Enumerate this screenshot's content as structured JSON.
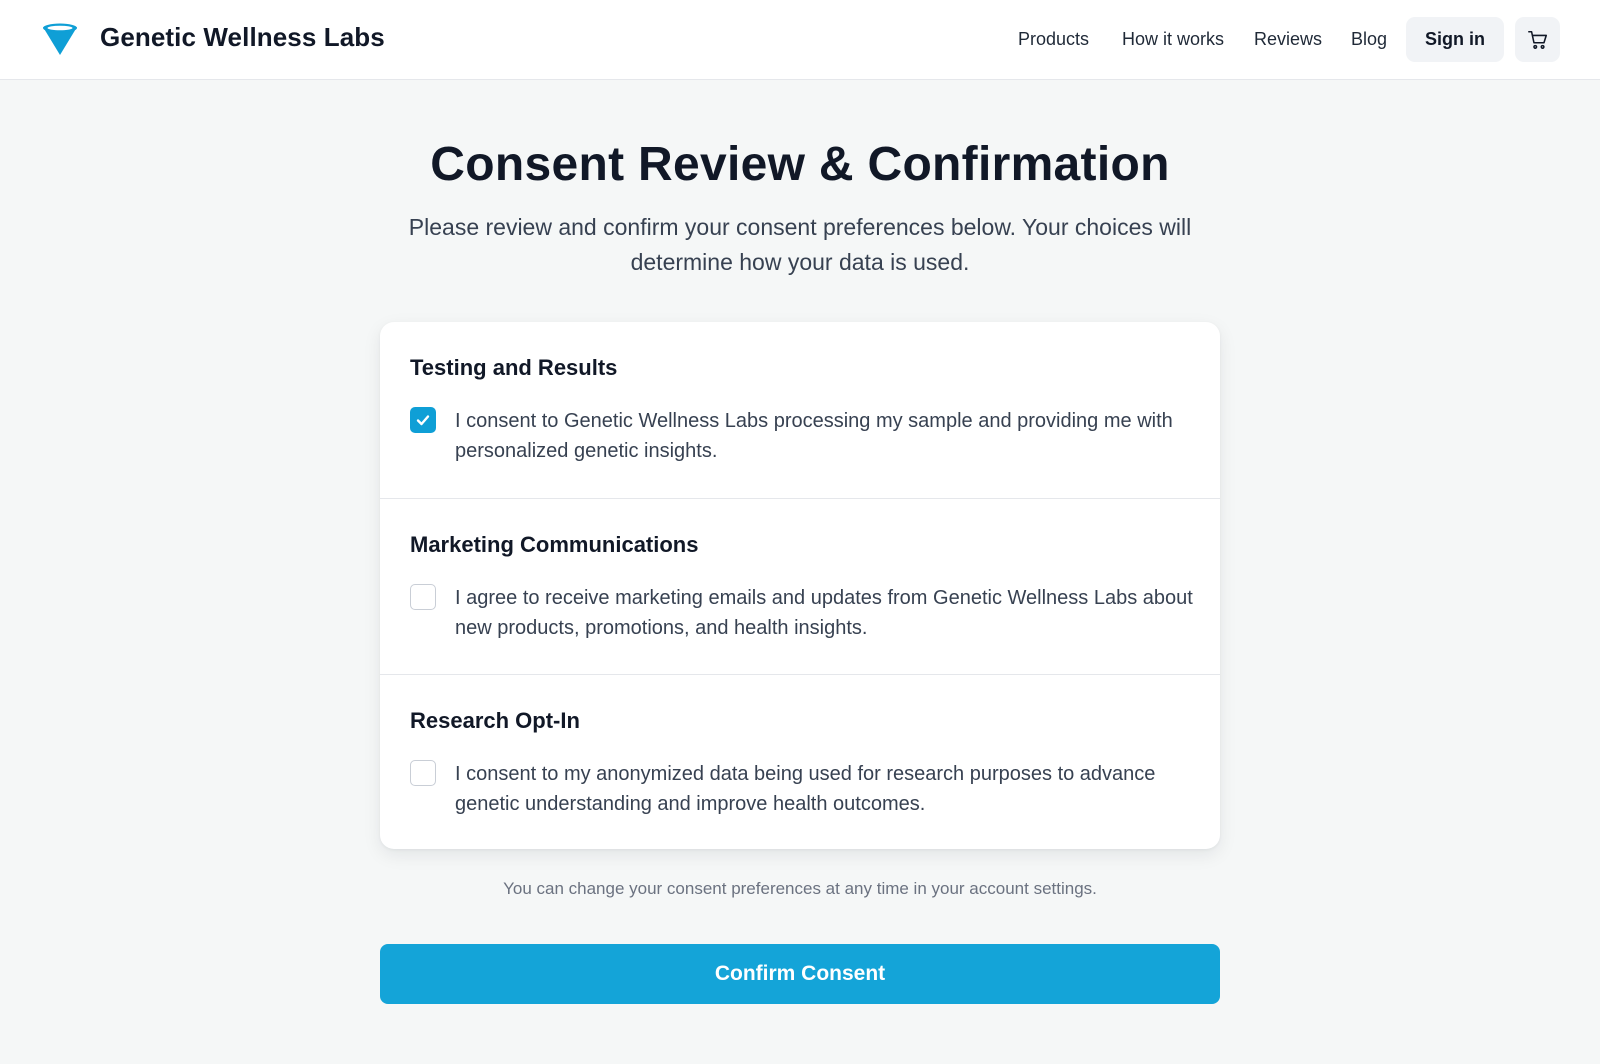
{
  "header": {
    "brand": "Genetic Wellness Labs",
    "logo_icon": "funnel-logo-icon",
    "nav": [
      "Products",
      "How it works",
      "Reviews",
      "Blog"
    ],
    "sign_in_label": "Sign in",
    "cart_icon": "shopping-cart-icon"
  },
  "main": {
    "title": "Consent Review & Confirmation",
    "subtitle": "Please review and confirm your consent preferences below. Your choices will determine how your data is used.",
    "sections": [
      {
        "title": "Testing and Results",
        "text": "I consent to Genetic Wellness Labs processing my sample and providing me with personalized genetic insights.",
        "checked": true
      },
      {
        "title": "Marketing Communications",
        "text": "I agree to receive marketing emails and updates from Genetic Wellness Labs about new products, promotions, and health insights.",
        "checked": false
      },
      {
        "title": "Research Opt-In",
        "text": "I consent to my anonymized data being used for research purposes to advance genetic understanding and improve health outcomes.",
        "checked": false
      }
    ],
    "note": "You can change your consent preferences at any time in your account settings.",
    "confirm_label": "Confirm Consent"
  },
  "colors": {
    "accent": "#14a4d8",
    "background": "#f5f7f7",
    "text_dark": "#111827",
    "text_muted": "#6b7280"
  }
}
